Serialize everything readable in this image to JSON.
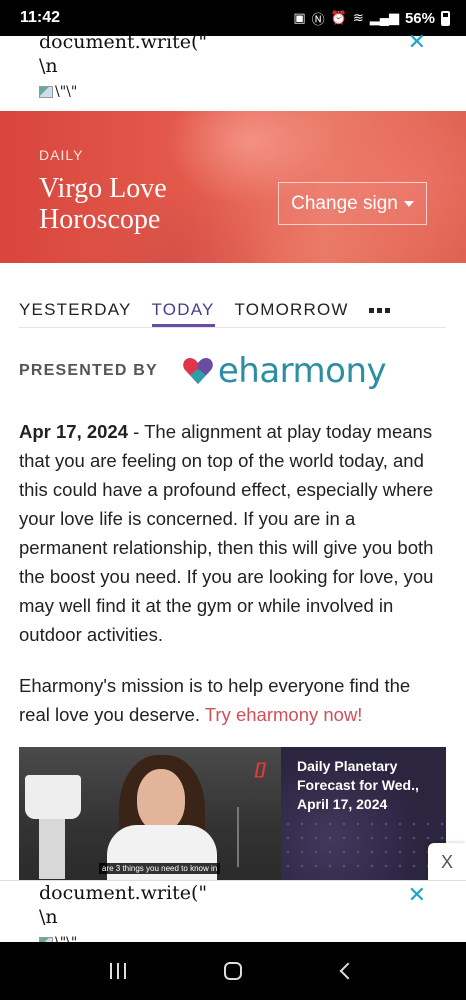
{
  "status_bar": {
    "time": "11:42",
    "icons": [
      "sim-icon",
      "nfc-icon",
      "alarm-icon",
      "wifi-icon",
      "signal-icon"
    ],
    "battery": "56%"
  },
  "ad_top": {
    "code_line1": "document.write(\"",
    "code_line2": "\\n",
    "img_alt": "\\\"\\\"",
    "close": "✕"
  },
  "hero": {
    "kicker": "DAILY",
    "title": "Virgo Love Horoscope",
    "change_sign": "Change sign"
  },
  "tabs": [
    {
      "label": "YESTERDAY",
      "active": false
    },
    {
      "label": "TODAY",
      "active": true
    },
    {
      "label": "TOMORROW",
      "active": false
    }
  ],
  "sponsor": {
    "label": "PRESENTED BY",
    "brand": "eharmony",
    "colors": {
      "brand_text": "#2a8fa2",
      "heart_left": "#e0344a",
      "heart_right": "#6a4ca3",
      "heart_bottom": "#2aa0a8"
    }
  },
  "article": {
    "date": "Apr 17, 2024",
    "body": " - The alignment at play today means that you are feeling on top of the world today, and this could have a profound effect, especially where your love life is concerned. If you are in a permanent relationship, then this will give you both the boost you need. If you are looking for love, you may well find it at the gym or while involved in outdoor activities.",
    "mission": "Eharmony's mission is to help everyone find the real love you deserve. ",
    "cta_link": "Try eharmony now!"
  },
  "video": {
    "subtitle": "are 3 things you need to know in",
    "bracket": "[]",
    "title": "Daily Planetary Forecast for Wed., April 17, 2024",
    "close": "X"
  },
  "ad_bottom": {
    "code_line1": "document.write(\"",
    "code_line2": "\\n",
    "img_alt": "\\\"\\\"",
    "close": "✕"
  },
  "colors": {
    "accent_tab": "#6a4ca3",
    "link": "#d0505a",
    "ad_close": "#1aa6c8"
  }
}
